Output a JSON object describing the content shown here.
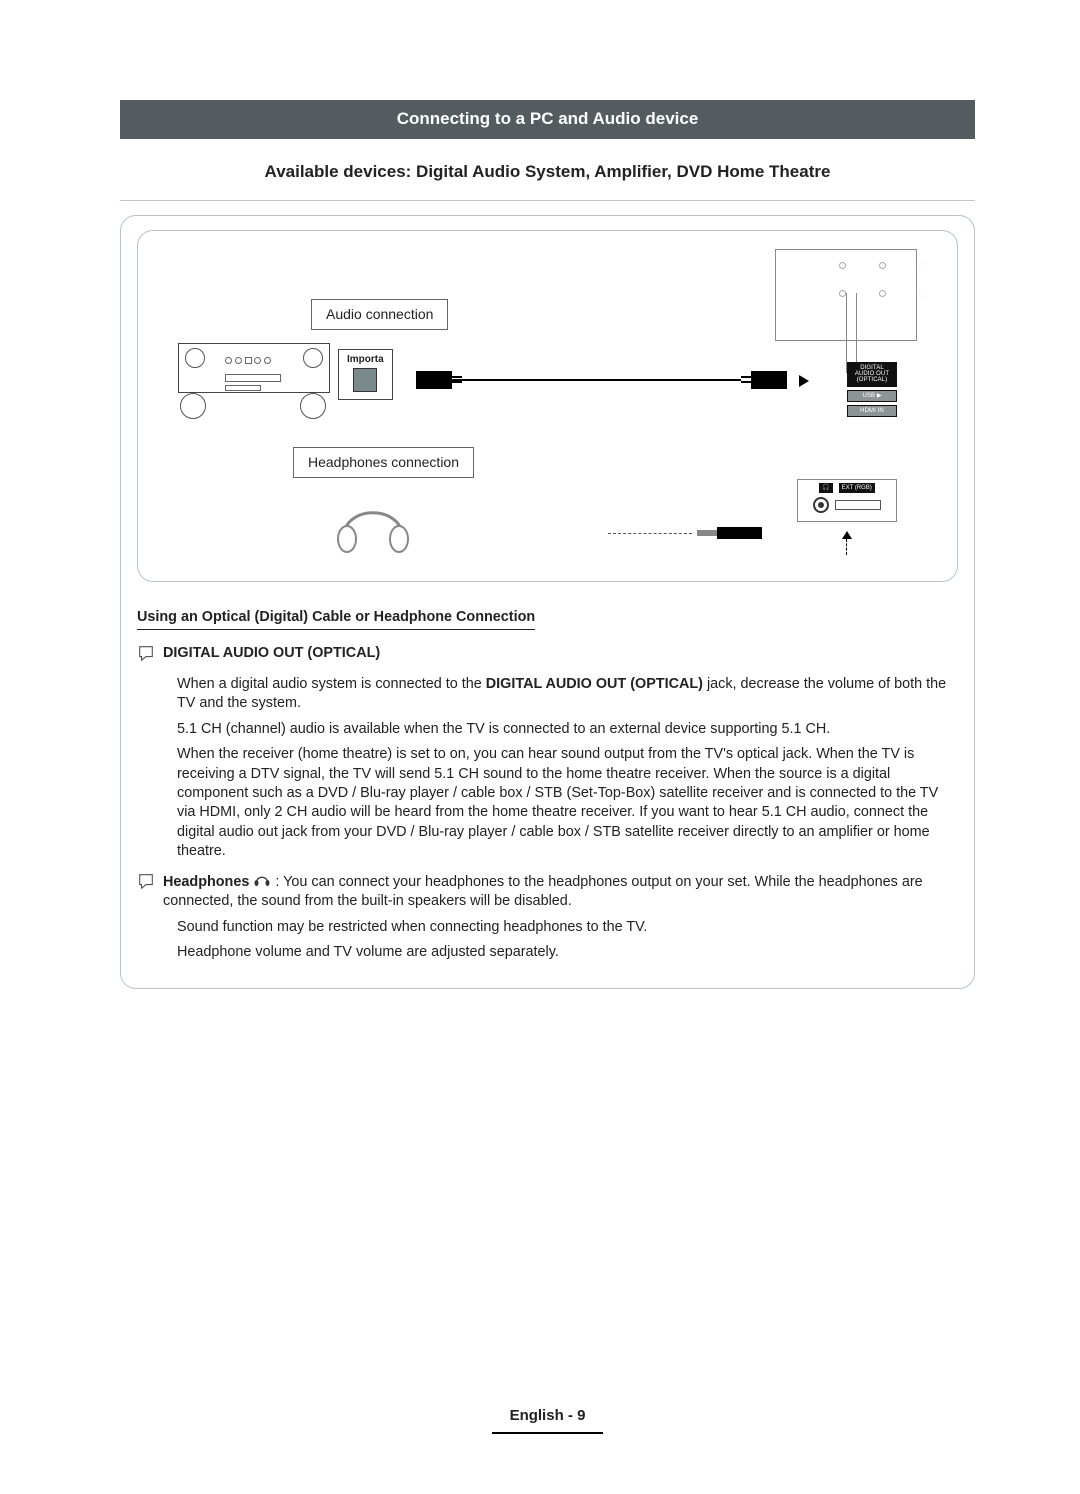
{
  "section_title": "Connecting to a PC and Audio device",
  "subtitle": "Available devices: Digital Audio System, Amplifier, DVD Home Theatre",
  "diagram": {
    "audio_label": "Audio connection",
    "headphones_label": "Headphones connection",
    "importa": "Importa",
    "ports": {
      "digital_audio_out": "DIGITAL\nAUDIO OUT\n(OPTICAL)",
      "usb": "USB ▶",
      "hdmi_in": "HDMI IN",
      "ext_rgb": "EXT (RGB)"
    }
  },
  "using_heading": "Using an Optical (Digital) Cable or Headphone Connection",
  "digital_audio_heading": "DIGITAL AUDIO OUT (OPTICAL)",
  "digital_bullets": [
    {
      "pre": "When a digital audio system is connected to the ",
      "strong": "DIGITAL AUDIO OUT (OPTICAL)",
      "post": " jack, decrease the volume of both the TV and the system."
    },
    {
      "text": "5.1 CH (channel) audio is available when the TV is connected to an external device supporting 5.1 CH."
    },
    {
      "text": "When the receiver (home theatre) is set to on, you can hear sound output from the TV's optical jack. When the TV is receiving a DTV signal, the TV will send 5.1 CH sound to the home theatre receiver. When the source is a digital component such as a DVD / Blu-ray player / cable box / STB (Set-Top-Box) satellite receiver and is connected to the TV via HDMI, only 2 CH audio will be heard from the home theatre receiver. If you want to hear 5.1 CH audio, connect the digital audio out jack from your DVD / Blu-ray player / cable box / STB satellite receiver directly to an amplifier or home theatre."
    }
  ],
  "headphones_heading": "Headphones",
  "headphones_lead": ": You can connect your headphones to the headphones output on your set. While the headphones are connected, the sound from the built-in speakers will be disabled.",
  "headphones_bullets": [
    "Sound function may be restricted when connecting headphones to the TV.",
    "Headphone volume and TV volume are adjusted separately."
  ],
  "footer": {
    "lang": "English",
    "sep": " - ",
    "page": "9"
  }
}
